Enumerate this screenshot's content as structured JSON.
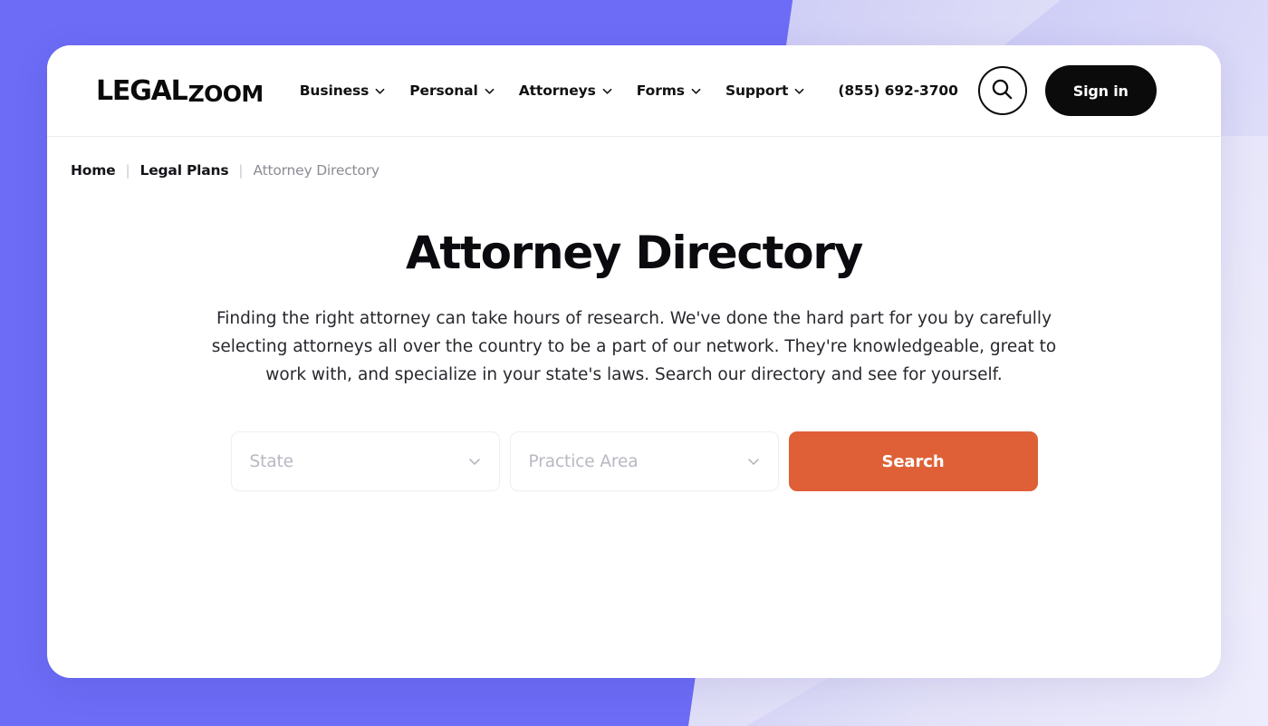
{
  "theme": {
    "page_background_purple": "#6C6CF6",
    "page_background_lavender": "#E4E3F8",
    "card_background": "#FFFFFF",
    "accent_orange": "#DF6036",
    "text_dark": "#0B0B0F",
    "text_muted": "#8C8C96",
    "placeholder_gray": "#B8B8C2"
  },
  "header": {
    "logo": {
      "part1": "LEGAL",
      "part2": "ZOOM",
      "full": "LEGALZOOM"
    },
    "nav": [
      {
        "label": "Business",
        "icon": "chevron-down-icon"
      },
      {
        "label": "Personal",
        "icon": "chevron-down-icon"
      },
      {
        "label": "Attorneys",
        "icon": "chevron-down-icon"
      },
      {
        "label": "Forms",
        "icon": "chevron-down-icon"
      },
      {
        "label": "Support",
        "icon": "chevron-down-icon"
      }
    ],
    "phone": "(855) 692-3700",
    "search_icon": "search-icon",
    "signin_label": "Sign in"
  },
  "breadcrumb": {
    "items": [
      {
        "label": "Home",
        "current": false
      },
      {
        "label": "Legal Plans",
        "current": false
      },
      {
        "label": "Attorney Directory",
        "current": true
      }
    ],
    "separator": "|"
  },
  "hero": {
    "title": "Attorney Directory",
    "description": "Finding the right attorney can take hours of research. We've done the hard part for you by carefully selecting attorneys all over the country to be a part of our network. They're knowledgeable, great to work with, and specialize in your state's laws. Search our directory and see for yourself."
  },
  "search_form": {
    "state_select": {
      "placeholder": "State",
      "value": "",
      "icon": "chevron-down-icon"
    },
    "practice_area_select": {
      "placeholder": "Practice Area",
      "value": "",
      "icon": "chevron-down-icon"
    },
    "submit_label": "Search"
  }
}
